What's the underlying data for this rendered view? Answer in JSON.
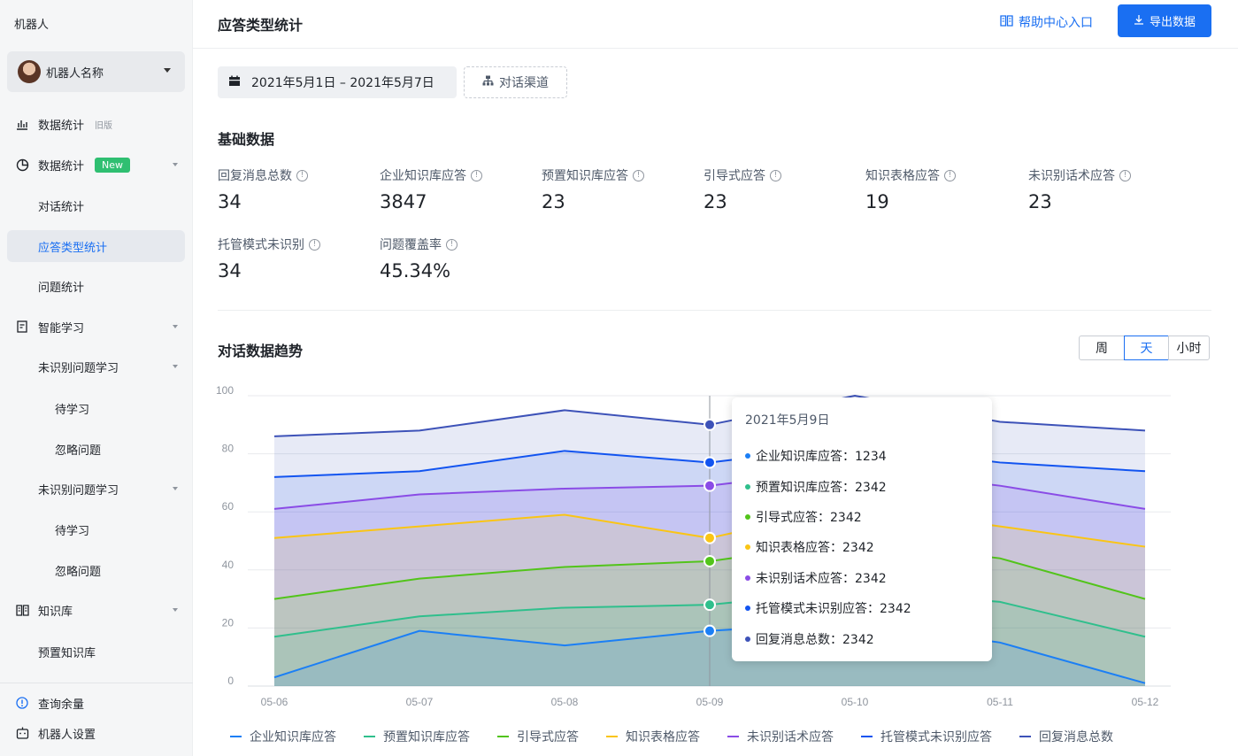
{
  "sidebar": {
    "title": "机器人",
    "bot_name": "机器人名称",
    "items": [
      {
        "label": "数据统计",
        "tag": "旧版"
      },
      {
        "label": "数据统计",
        "tag": "New"
      },
      {
        "label": "对话统计"
      },
      {
        "label": "应答类型统计"
      },
      {
        "label": "问题统计"
      },
      {
        "label": "智能学习"
      },
      {
        "label": "未识别问题学习"
      },
      {
        "label": "待学习"
      },
      {
        "label": "忽略问题"
      },
      {
        "label": "未识别问题学习"
      },
      {
        "label": "待学习"
      },
      {
        "label": "忽略问题"
      },
      {
        "label": "知识库"
      },
      {
        "label": "预置知识库"
      }
    ],
    "footer": [
      {
        "label": "查询余量"
      },
      {
        "label": "机器人设置"
      }
    ]
  },
  "header": {
    "title": "应答类型统计",
    "help_label": "帮助中心入口",
    "export_label": "导出数据"
  },
  "filters": {
    "date_range": "2021年5月1日 – 2021年5月7日",
    "channel_label": "对话渠道"
  },
  "basic": {
    "title": "基础数据",
    "stats": [
      {
        "label": "回复消息总数",
        "value": "34"
      },
      {
        "label": "企业知识库应答",
        "value": "3847"
      },
      {
        "label": "预置知识库应答",
        "value": "23"
      },
      {
        "label": "引导式应答",
        "value": "23"
      },
      {
        "label": "知识表格应答",
        "value": "19"
      },
      {
        "label": "未识别话术应答",
        "value": "23"
      },
      {
        "label": "托管模式未识别",
        "value": "34"
      },
      {
        "label": "问题覆盖率",
        "value": "45.34%"
      }
    ]
  },
  "trend": {
    "title": "对话数据趋势",
    "granularity": [
      "周",
      "天",
      "小时"
    ],
    "selected": "天"
  },
  "chart_data": {
    "type": "area",
    "categories": [
      "05-06",
      "05-07",
      "05-08",
      "05-09",
      "05-10",
      "05-11",
      "05-12"
    ],
    "ylim": [
      0,
      100
    ],
    "yticks": [
      0,
      20,
      40,
      60,
      80,
      100
    ],
    "series": [
      {
        "name": "企业知识库应答",
        "color": "#1b7ff5",
        "values": [
          3,
          19,
          14,
          19,
          22,
          15,
          1
        ]
      },
      {
        "name": "预置知识库应答",
        "color": "#2fbf8c",
        "values": [
          17,
          24,
          27,
          28,
          33,
          29,
          17
        ]
      },
      {
        "name": "引导式应答",
        "color": "#52c41a",
        "values": [
          30,
          37,
          41,
          43,
          50,
          44,
          30
        ]
      },
      {
        "name": "知识表格应答",
        "color": "#fac515",
        "values": [
          51,
          55,
          59,
          51,
          62,
          55,
          48
        ]
      },
      {
        "name": "未识别话术应答",
        "color": "#8a4ce6",
        "values": [
          61,
          66,
          68,
          69,
          75,
          69,
          61
        ]
      },
      {
        "name": "托管模式未识别应答",
        "color": "#1254f0",
        "values": [
          72,
          74,
          81,
          77,
          83,
          77,
          74
        ]
      },
      {
        "name": "回复消息总数",
        "color": "#3d52b8",
        "values": [
          86,
          88,
          95,
          90,
          100,
          91,
          88
        ]
      }
    ],
    "tooltip": {
      "date": "2021年5月9日",
      "category": "05-09",
      "rows": [
        {
          "label": "企业知识库应答：1234",
          "color": "#1b7ff5"
        },
        {
          "label": "预置知识库应答：2342",
          "color": "#2fbf8c"
        },
        {
          "label": "引导式应答：2342",
          "color": "#52c41a"
        },
        {
          "label": "知识表格应答：2342",
          "color": "#fac515"
        },
        {
          "label": "未识别话术应答：2342",
          "color": "#8a4ce6"
        },
        {
          "label": "托管模式未识别应答：2342",
          "color": "#1254f0"
        },
        {
          "label": "回复消息总数：2342",
          "color": "#3d52b8"
        }
      ]
    }
  }
}
